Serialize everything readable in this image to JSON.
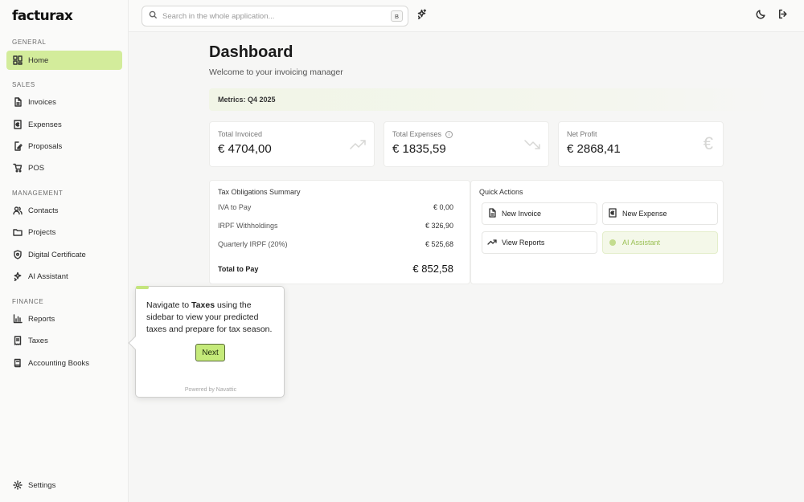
{
  "app": {
    "logo": "facturax"
  },
  "search": {
    "placeholder": "Search in the whole application...",
    "shortcut": "B"
  },
  "sidebar": {
    "sections": [
      {
        "title": "GENERAL"
      },
      {
        "title": "SALES"
      },
      {
        "title": "MANAGEMENT"
      },
      {
        "title": "FINANCE"
      }
    ],
    "items": [
      {
        "label": "Home",
        "icon": "dashboard-icon",
        "active": true
      },
      {
        "label": "Invoices",
        "icon": "invoice-icon"
      },
      {
        "label": "Expenses",
        "icon": "euro-receipt-icon"
      },
      {
        "label": "Proposals",
        "icon": "document-pen-icon"
      },
      {
        "label": "POS",
        "icon": "cart-icon"
      },
      {
        "label": "Contacts",
        "icon": "users-icon"
      },
      {
        "label": "Projects",
        "icon": "folder-icon"
      },
      {
        "label": "Digital Certificate",
        "icon": "shield-icon"
      },
      {
        "label": "AI Assistant",
        "icon": "sparkle-icon"
      },
      {
        "label": "Reports",
        "icon": "bar-chart-icon"
      },
      {
        "label": "Taxes",
        "icon": "tax-receipt-icon"
      },
      {
        "label": "Accounting Books",
        "icon": "book-icon"
      },
      {
        "label": "Settings",
        "icon": "gear-icon"
      }
    ]
  },
  "main": {
    "title": "Dashboard",
    "subtitle": "Welcome to your invoicing manager",
    "metrics_label": "Metrics: Q4 2025",
    "cards": [
      {
        "label": "Total Invoiced",
        "value": "€ 4704,00",
        "icon": "trending-up-icon"
      },
      {
        "label": "Total Expenses",
        "value": "€ 1835,59",
        "icon": "trending-down-icon"
      },
      {
        "label": "Net Profit",
        "value": "€ 2868,41",
        "icon": "euro-icon"
      }
    ],
    "tax_summary": {
      "title": "Tax Obligations Summary",
      "rows": [
        {
          "label": "IVA to Pay",
          "amount": "€ 0,00"
        },
        {
          "label": "IRPF Withholdings",
          "amount": "€ 326,90"
        },
        {
          "label": "Quarterly IRPF (20%)",
          "amount": "€ 525,68"
        }
      ],
      "total_label": "Total to Pay",
      "total_amount": "€ 852,58"
    },
    "quick_actions": {
      "title": "Quick Actions",
      "buttons": [
        {
          "label": "New Invoice",
          "icon": "document-icon"
        },
        {
          "label": "New Expense",
          "icon": "euro-receipt-icon"
        },
        {
          "label": "View Reports",
          "icon": "trending-up-icon"
        },
        {
          "label": "AI Assistant",
          "icon": "dot-icon"
        }
      ]
    }
  },
  "tour": {
    "text_before": "Navigate to ",
    "text_bold": "Taxes",
    "text_after": " using the sidebar to view your predicted taxes and prepare for tax season.",
    "next_label": "Next",
    "footer": "Powered by Navattic"
  },
  "colors": {
    "accent": "#c5ea7a",
    "active_nav": "#d3ec9b"
  }
}
